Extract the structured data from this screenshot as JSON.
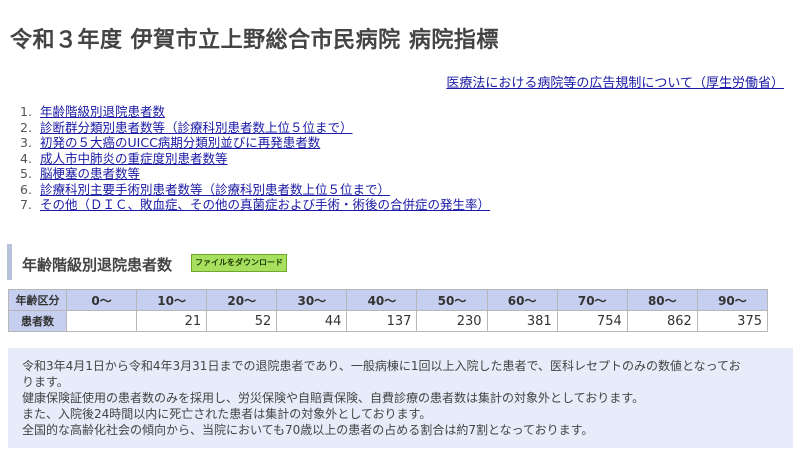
{
  "page": {
    "title": "令和３年度 伊賀市立上野総合市民病院 病院指標",
    "mhlw_link": "医療法における病院等の広告規制について（厚生労働省）"
  },
  "index": [
    {
      "num": "1.",
      "label": "年齢階級別退院患者数"
    },
    {
      "num": "2.",
      "label": "診断群分類別患者数等（診療科別患者数上位５位まで）"
    },
    {
      "num": "3.",
      "label": "初発の５大癌のUICC病期分類別並びに再発患者数"
    },
    {
      "num": "4.",
      "label": "成人市中肺炎の重症度別患者数等"
    },
    {
      "num": "5.",
      "label": "脳梗塞の患者数等"
    },
    {
      "num": "6.",
      "label": "診療科別主要手術別患者数等（診療科別患者数上位５位まで）"
    },
    {
      "num": "7.",
      "label": "その他（ＤＩＣ、敗血症、その他の真菌症および手術・術後の合併症の発生率）"
    }
  ],
  "section": {
    "title": "年齢階級別退院患者数",
    "download_label": "ファイルをダウンロード"
  },
  "table": {
    "header_label": "年齢区分",
    "row_label": "患者数",
    "columns": [
      "0〜",
      "10〜",
      "20〜",
      "30〜",
      "40〜",
      "50〜",
      "60〜",
      "70〜",
      "80〜",
      "90〜"
    ],
    "values": [
      "",
      "21",
      "52",
      "44",
      "137",
      "230",
      "381",
      "754",
      "862",
      "375"
    ]
  },
  "notes": [
    "令和3年4月1日から令和4年3月31日までの退院患者であり、一般病棟に1回以上入院した患者で、医科レセプトのみの数値となってお",
    "ります。",
    "健康保険証使用の患者数のみを採用し、労災保険や自賠責保険、自費診療の患者数は集計の対象外としております。",
    "また、入院後24時間以内に死亡された患者は集計の対象外としております。",
    "全国的な高齢化社会の傾向から、当院においても70歳以上の患者の占める割合は約7割となっております。"
  ],
  "colors": {
    "link": "#1a1aa6",
    "table_header": "#c6cff0",
    "note_background": "#e6ecf9",
    "download_button": "#a6e05e",
    "section_bar": "#b7c2dd"
  }
}
